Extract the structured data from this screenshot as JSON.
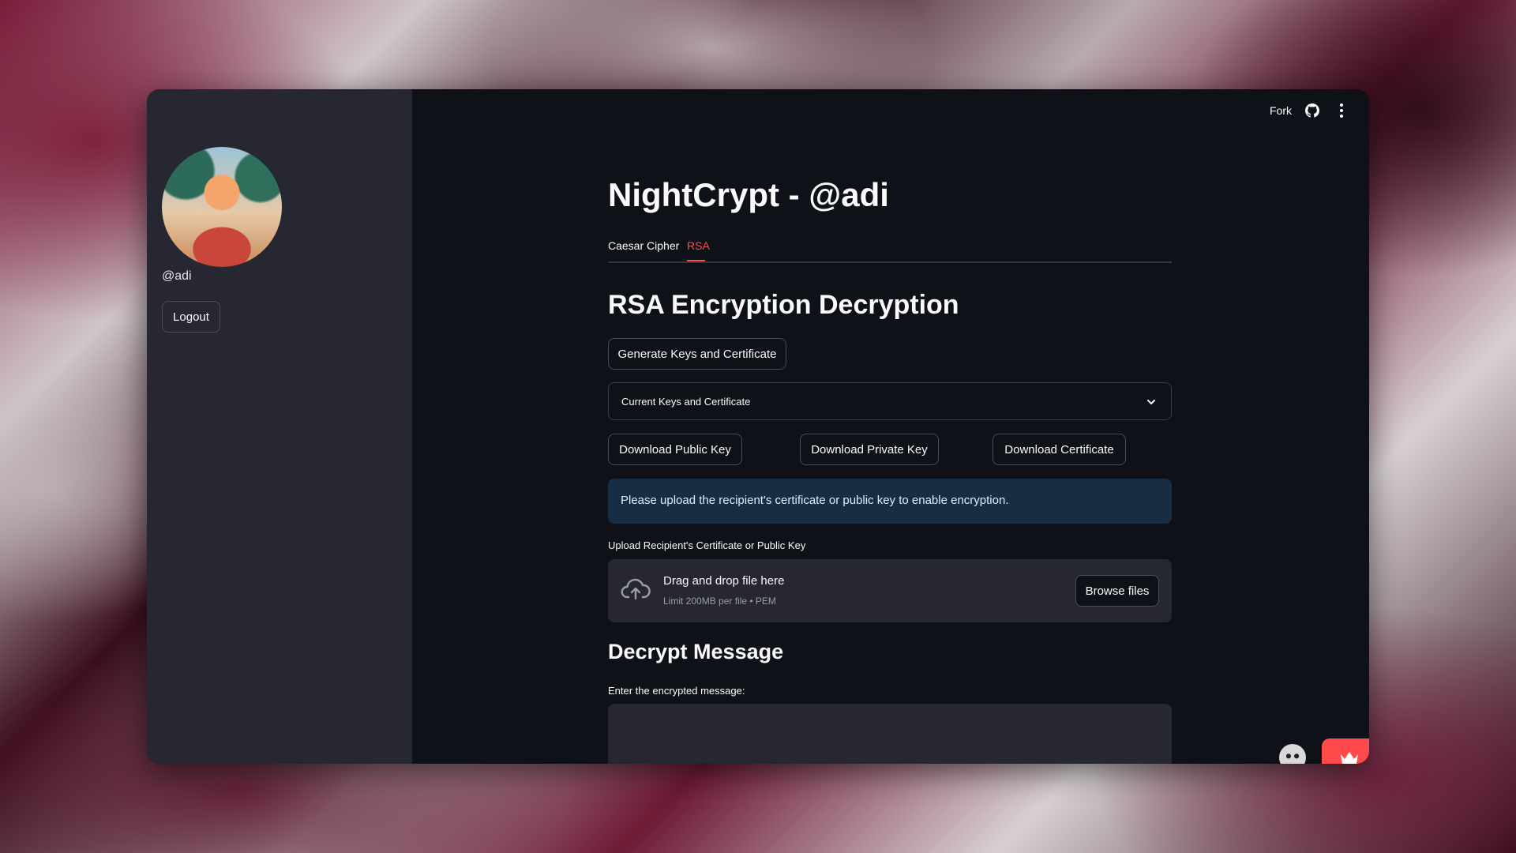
{
  "app": {
    "title": "NightCrypt - @adi"
  },
  "toolbar": {
    "fork_label": "Fork",
    "icons": [
      "github-icon",
      "kebab-menu-icon"
    ]
  },
  "sidebar": {
    "username": "@adi",
    "logout_label": "Logout"
  },
  "tabs": [
    {
      "label": "Caesar Cipher",
      "active": false
    },
    {
      "label": "RSA",
      "active": true
    }
  ],
  "rsa": {
    "heading": "RSA Encryption Decryption",
    "generate_label": "Generate Keys and Certificate",
    "expander_label": "Current Keys and Certificate",
    "download_public_label": "Download Public Key",
    "download_private_label": "Download Private Key",
    "download_certificate_label": "Download Certificate",
    "info_message": "Please upload the recipient's certificate or public key to enable encryption.",
    "upload_label": "Upload Recipient's Certificate or Public Key",
    "dropzone_title": "Drag and drop file here",
    "dropzone_limit": "Limit 200MB per file • PEM",
    "browse_label": "Browse files"
  },
  "decrypt": {
    "heading": "Decrypt Message",
    "input_label": "Enter the encrypted message:",
    "input_value": ""
  },
  "colors": {
    "accent": "#ff4b4b",
    "background": "#0e1117",
    "sidebar": "#262730",
    "info_bg": "#172d43"
  }
}
